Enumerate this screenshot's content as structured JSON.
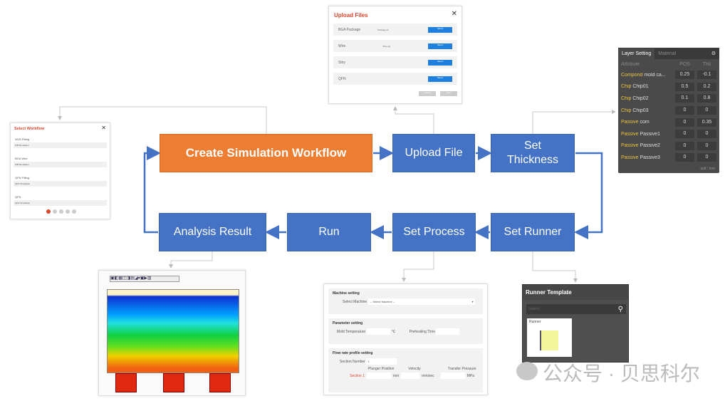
{
  "steps": {
    "create": "Create Simulation Workflow",
    "upload": "Upload File",
    "thickness": "Set Thickness",
    "runner": "Set Runner",
    "process": "Set Process",
    "run": "Run",
    "analysis": "Analysis Result"
  },
  "colors": {
    "orange": "#ED7D31",
    "blue": "#4472C4",
    "connector": "#bfbfbf"
  },
  "select_workflow": {
    "title": "Select Workflow",
    "items": [
      {
        "name": "WLB Filling",
        "sub": "WB Simulation"
      },
      {
        "name": "BGA Wire",
        "sub": "WB Simulation"
      },
      {
        "name": "QFN Filling",
        "sub": "QFN Simulation"
      },
      {
        "name": "QFN",
        "sub": "QFN Simulation"
      }
    ]
  },
  "upload_files": {
    "title": "Upload Files",
    "rows": [
      {
        "label": "BGA Package",
        "file": "Package.stl",
        "button": "Select"
      },
      {
        "label": "Wire",
        "file": "Wire.igs",
        "button": "Select"
      },
      {
        "label": "Stiry",
        "file": "",
        "button": "Select"
      },
      {
        "label": "QFN",
        "file": "",
        "button": "Select"
      }
    ],
    "cancel": "Cancel",
    "next": "Next"
  },
  "layer_setting": {
    "tabs": [
      "Layer Setting",
      "Material"
    ],
    "headers": [
      "Attribute",
      "POS",
      "Thk"
    ],
    "rows": [
      {
        "type": "Compond",
        "name": "mold ca...",
        "pos": "0.25",
        "thk": "-0.1"
      },
      {
        "type": "Chip",
        "name": "Chip01",
        "pos": "0.5",
        "thk": "0.2"
      },
      {
        "type": "Chip",
        "name": "Chip02",
        "pos": "0.1",
        "thk": "0.8"
      },
      {
        "type": "Chip",
        "name": "Chip03",
        "pos": "0",
        "thk": "0"
      },
      {
        "type": "Passive",
        "name": "com",
        "pos": "0",
        "thk": "0.35"
      },
      {
        "type": "Passive",
        "name": "Passive1",
        "pos": "0",
        "thk": "0"
      },
      {
        "type": "Passive",
        "name": "Passive2",
        "pos": "0",
        "thk": "0"
      },
      {
        "type": "Passive",
        "name": "Passive3",
        "pos": "0",
        "thk": "0"
      }
    ],
    "footer": "unit : mm"
  },
  "process": {
    "machine_title": "Machine setting",
    "select_machine_label": "Select Machine",
    "select_machine_value": "-- Select Machine --",
    "param_title": "Parameter setting",
    "mold_temp_label": "Mold Temperature",
    "mold_temp_unit": "℃",
    "preheat_label": "Preheating Time",
    "flow_title": "Flow rate profile setting",
    "section_number_label": "Section Number",
    "section_number_value": "1",
    "cols": [
      "Plunger Position",
      "Velocity",
      "Transfer Pressure"
    ],
    "section_label": "Section 1",
    "units": [
      "mm",
      "mm/sec",
      "MPa"
    ]
  },
  "runner_template": {
    "title": "Runner Template",
    "search_placeholder": "Search",
    "card_label": "Runner"
  },
  "watermark": "公众号 · 贝思科尔"
}
